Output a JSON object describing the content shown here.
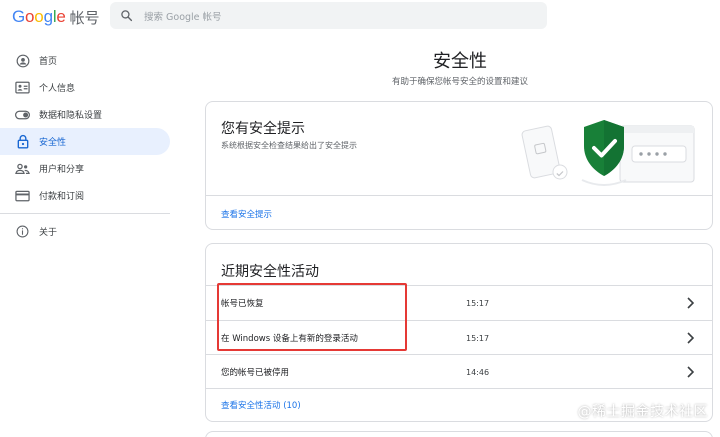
{
  "header": {
    "logo_letters": [
      "G",
      "o",
      "o",
      "g",
      "l",
      "e"
    ],
    "product_name": "帐号",
    "search_placeholder": "搜索 Google 帐号"
  },
  "sidebar": {
    "items": [
      {
        "label": "首页",
        "icon": "home-icon",
        "active": false
      },
      {
        "label": "个人信息",
        "icon": "person-card-icon",
        "active": false
      },
      {
        "label": "数据和隐私设置",
        "icon": "toggle-icon",
        "active": false
      },
      {
        "label": "安全性",
        "icon": "lock-icon",
        "active": true
      },
      {
        "label": "用户和分享",
        "icon": "people-icon",
        "active": false
      },
      {
        "label": "付款和订阅",
        "icon": "credit-card-icon",
        "active": false
      }
    ],
    "about": {
      "label": "关于",
      "icon": "info-icon"
    }
  },
  "main": {
    "title": "安全性",
    "subtitle": "有助于确保您帐号安全的设置和建议",
    "tips_card": {
      "title": "您有安全提示",
      "description": "系统根据安全检查结果给出了安全提示",
      "link": "查看安全提示"
    },
    "activity_card": {
      "title": "近期安全性活动",
      "events": [
        {
          "label": "帐号已恢复",
          "time": "15:17"
        },
        {
          "label": "在 Windows 设备上有新的登录活动",
          "time": "15:17"
        },
        {
          "label": "您的帐号已被停用",
          "time": "14:46"
        }
      ],
      "link": "查看安全性活动 (10)"
    }
  },
  "watermark": "@稀土掘金技术社区",
  "colors": {
    "accent": "#1a73e8",
    "active_bg": "#e8f0fe",
    "shield": "#188038",
    "highlight": "#e53935"
  }
}
